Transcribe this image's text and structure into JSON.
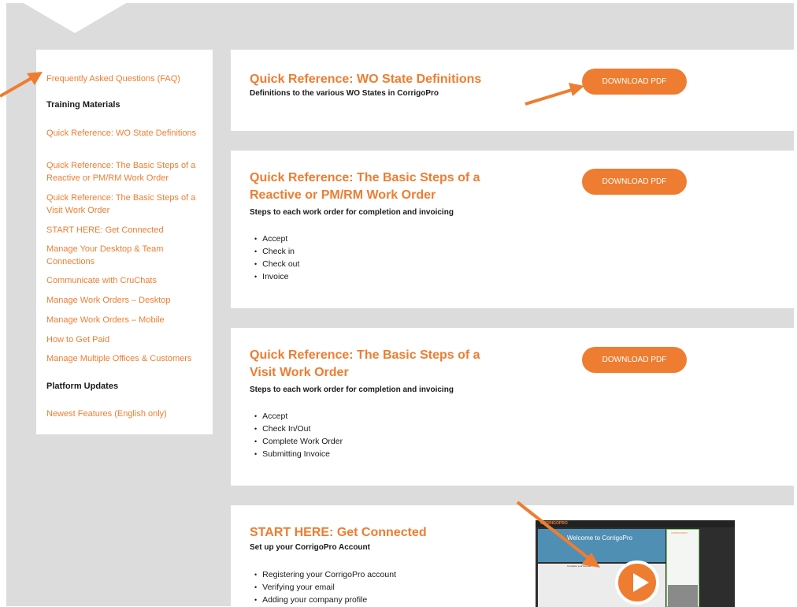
{
  "sidebar": {
    "faq_link": "Frequently Asked Questions (FAQ)",
    "training_heading": "Training Materials",
    "training_links": [
      "Quick Reference: WO State Definitions",
      "Quick Reference: The Basic Steps of a Reactive or PM/RM Work Order",
      "Quick Reference: The Basic Steps of a Visit Work Order",
      "START HERE: Get Connected",
      "Manage Your Desktop & Team Connections",
      "Communicate with CruChats",
      "Manage Work Orders – Desktop",
      "Manage Work Orders – Mobile",
      "How to Get Paid",
      "Manage Multiple Offices & Customers"
    ],
    "platform_heading": "Platform Updates",
    "platform_links": [
      "Newest Features (English only)"
    ]
  },
  "cards": [
    {
      "title": "Quick Reference: WO State Definitions",
      "subtitle": "Definitions to the various WO States in CorrigoPro",
      "button": "DOWNLOAD PDF",
      "steps": []
    },
    {
      "title": "Quick Reference: The Basic Steps of a Reactive or PM/RM Work Order",
      "subtitle": "Steps to each work order for completion and invoicing",
      "button": "DOWNLOAD PDF",
      "steps": [
        "Accept",
        "Check in",
        "Check out",
        "Invoice"
      ]
    },
    {
      "title": "Quick Reference: The Basic Steps of a Visit Work Order",
      "subtitle": "Steps to each work order for completion and invoicing",
      "button": "DOWNLOAD PDF",
      "steps": [
        "Accept",
        "Check In/Out",
        "Complete Work Order",
        "Submitting Invoice"
      ]
    },
    {
      "title": "START HERE: Get Connected",
      "subtitle": "Set up your CorrigoPro Account",
      "steps": [
        "Registering your CorrigoPro account",
        "Verifying your email",
        "Adding your company profile"
      ],
      "video": {
        "logo": "CORRIGOPRO",
        "welcome": "Welcome to CorrigoPro",
        "card_heading": "Complete your Account",
        "side_logo": "CORRIGOPRO"
      }
    }
  ],
  "colors": {
    "accent": "#ee7d31",
    "background": "#dcdcdc",
    "card": "#ffffff",
    "text": "#1a1a1a"
  },
  "icons": {
    "annotation_arrow": "arrow-icon",
    "video_play": "play-icon"
  }
}
